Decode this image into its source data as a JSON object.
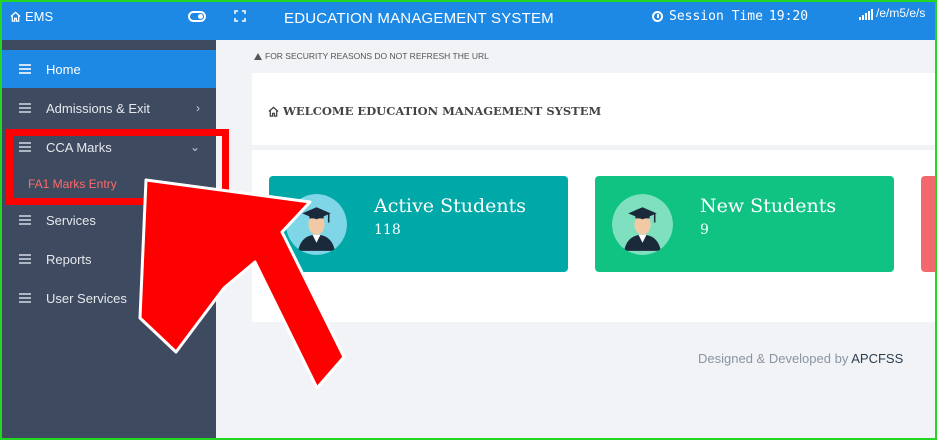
{
  "topbar": {
    "brand": "EMS",
    "system_title": "EDUCATION MANAGEMENT SYSTEM",
    "session_label": "Session Time",
    "session_time": "19:20",
    "url_fragment": "/e/m5/e/s"
  },
  "sidebar": {
    "items": [
      {
        "label": "Home"
      },
      {
        "label": "Admissions & Exit"
      },
      {
        "label": "CCA Marks"
      },
      {
        "label": "Services"
      },
      {
        "label": "Reports"
      },
      {
        "label": "User Services"
      }
    ],
    "subitem": "FA1 Marks Entry"
  },
  "main": {
    "notice": "FOR SECURITY REASONS DO NOT REFRESH THE URL",
    "welcome": "WELCOME EDUCATION MANAGEMENT SYSTEM",
    "stats": [
      {
        "label": "Active Students",
        "value": "118"
      },
      {
        "label": "New Students",
        "value": "9"
      }
    ]
  },
  "footer": {
    "text": "Designed & Developed by",
    "brand": "APCFSS"
  },
  "colors": {
    "topbar": "#1e88e5",
    "sidebar": "#3d4a5f",
    "active_students": "#00a8a8",
    "new_students": "#10c383",
    "annotation": "#ff0000"
  }
}
